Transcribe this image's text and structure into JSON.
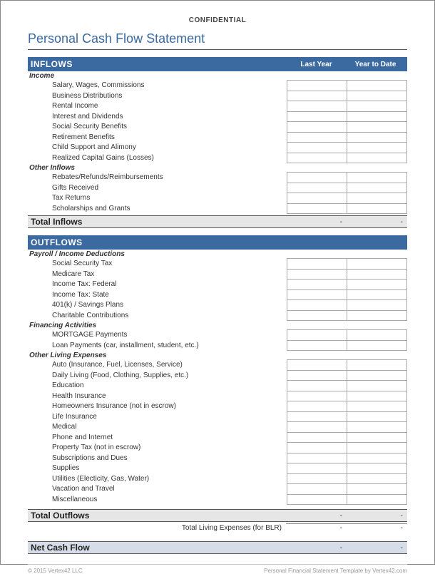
{
  "confidential": "CONFIDENTIAL",
  "title": "Personal Cash Flow Statement",
  "sections": {
    "inflows": {
      "header": "INFLOWS",
      "col1": "Last Year",
      "col2": "Year to Date",
      "categories": [
        {
          "name": "Income",
          "items": [
            "Salary, Wages, Commissions",
            "Business Distributions",
            "Rental Income",
            "Interest and Dividends",
            "Social Security Benefits",
            "Retirement Benefits",
            "Child Support and Alimony",
            "Realized Capital Gains (Losses)"
          ]
        },
        {
          "name": "Other Inflows",
          "items": [
            "Rebates/Refunds/Reimbursements",
            "Gifts Received",
            "Tax Returns",
            "Scholarships and Grants"
          ]
        }
      ],
      "total": {
        "label": "Total Inflows",
        "v1": "-",
        "v2": "-"
      }
    },
    "outflows": {
      "header": "OUTFLOWS",
      "col1": "",
      "col2": "",
      "categories": [
        {
          "name": "Payroll / Income Deductions",
          "items": [
            "Social Security Tax",
            "Medicare Tax",
            "Income Tax: Federal",
            "Income Tax: State",
            "401(k) / Savings Plans",
            "Charitable Contributions"
          ]
        },
        {
          "name": "Financing Activities",
          "items": [
            "MORTGAGE Payments",
            "Loan Payments (car, installment, student, etc.)"
          ]
        },
        {
          "name": "Other Living Expenses",
          "items": [
            "Auto (Insurance, Fuel, Licenses, Service)",
            "Daily Living (Food, Clothing, Supplies, etc.)",
            "Education",
            "Health Insurance",
            "Homeowners Insurance (not in escrow)",
            "Life Insurance",
            "Medical",
            "Phone and Internet",
            "Property Tax (not in escrow)",
            "Subscriptions and Dues",
            "Supplies",
            "Utilities (Electicity, Gas, Water)",
            "Vacation and Travel",
            "Miscellaneous"
          ]
        }
      ],
      "total": {
        "label": "Total Outflows",
        "v1": "-",
        "v2": "-"
      },
      "subtotal": {
        "label": "Total Living Expenses (for BLR)",
        "v1": "-",
        "v2": "-"
      }
    }
  },
  "net": {
    "label": "Net Cash Flow",
    "v1": "-",
    "v2": "-"
  },
  "footer": {
    "left": "© 2015 Vertex42 LLC",
    "right": "Personal Financial Statement Template by Vertex42.com"
  }
}
